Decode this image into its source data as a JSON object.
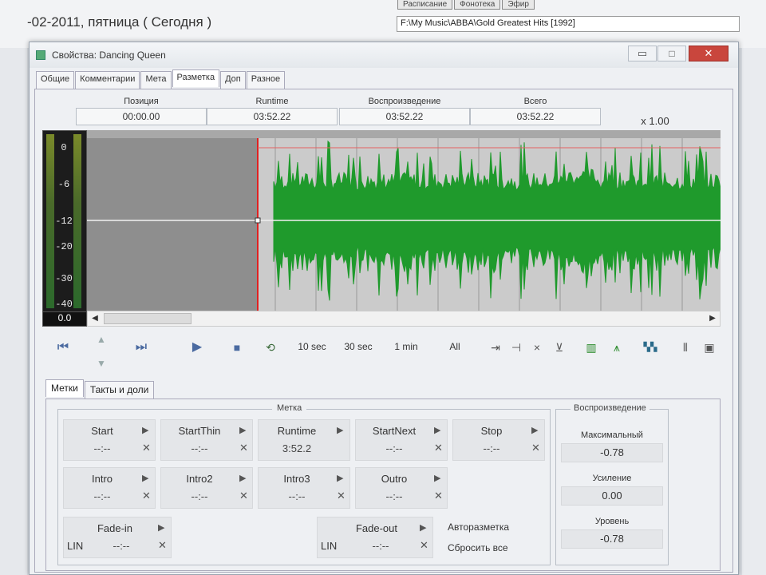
{
  "background": {
    "date_text": "-02-2011, пятница ( Сегодня )",
    "tabs": [
      "Расписание",
      "Фонотека",
      "Эфир"
    ],
    "path": "F:\\My Music\\ABBA\\Gold Greatest Hits [1992]"
  },
  "window": {
    "title": "Свойства: Dancing Queen",
    "tabs": [
      "Общие",
      "Комментарии",
      "Мета",
      "Разметка",
      "Доп",
      "Разное"
    ],
    "active_tab": "Разметка"
  },
  "info": {
    "position": {
      "label": "Позиция",
      "value": "00:00.00"
    },
    "runtime": {
      "label": "Runtime",
      "value": "03:52.22"
    },
    "playback": {
      "label": "Воспроизведение",
      "value": "03:52.22"
    },
    "total": {
      "label": "Всего",
      "value": "03:52.22"
    },
    "speed": "x 1.00"
  },
  "vu_meter": {
    "ticks": [
      "0",
      "-6",
      "-12",
      "-20",
      "-30",
      "-40"
    ],
    "value": "0.0"
  },
  "toolbar": {
    "zoom_10": "10 sec",
    "zoom_30": "30 sec",
    "zoom_1m": "1 min",
    "zoom_all": "All",
    "icons": [
      "rewind-icon",
      "up-icon",
      "down-icon",
      "forward-icon",
      "play-icon",
      "stop-icon",
      "loop-icon"
    ]
  },
  "bottom_tabs": [
    "Метки",
    "Такты и доли"
  ],
  "markers": {
    "group_title": "Метка",
    "cells": [
      {
        "name": "Start",
        "value": "--:--"
      },
      {
        "name": "StartThin",
        "value": "--:--"
      },
      {
        "name": "Runtime",
        "value": "3:52.2"
      },
      {
        "name": "StartNext",
        "value": "--:--"
      },
      {
        "name": "Stop",
        "value": "--:--"
      },
      {
        "name": "Intro",
        "value": "--:--"
      },
      {
        "name": "Intro2",
        "value": "--:--"
      },
      {
        "name": "Intro3",
        "value": "--:--"
      },
      {
        "name": "Outro",
        "value": "--:--"
      },
      {
        "name": "Fade-in",
        "value": "--:--"
      },
      {
        "name": "Fade-out",
        "value": "--:--"
      }
    ],
    "fade_in_mode": "LIN",
    "fade_out_mode": "LIN",
    "auto_markup": "Авторазметка",
    "reset_all": "Сбросить все"
  },
  "playback": {
    "group_title": "Воспроизведение",
    "max_label": "Максимальный",
    "max_value": "-0.78",
    "gain_label": "Усиление",
    "gain_value": "0.00",
    "level_label": "Уровень",
    "level_value": "-0.78"
  },
  "colors": {
    "waveform": "#1f9a2c",
    "background_wave": "#c8c8c8",
    "playhead": "#e02020",
    "close_button": "#c9463d"
  }
}
